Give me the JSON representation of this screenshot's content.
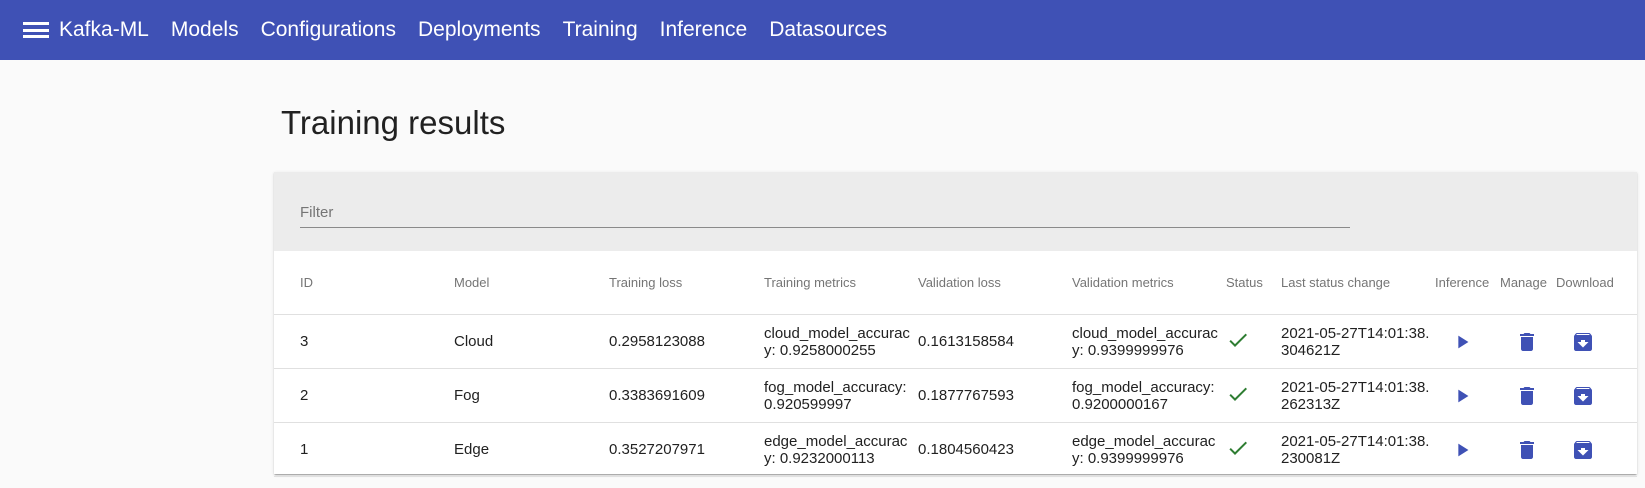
{
  "app": {
    "title": "Kafka-ML",
    "nav": [
      "Models",
      "Configurations",
      "Deployments",
      "Training",
      "Inference",
      "Datasources"
    ]
  },
  "page": {
    "title": "Training results"
  },
  "filter": {
    "placeholder": "Filter",
    "value": ""
  },
  "table": {
    "headers": {
      "id": "ID",
      "model": "Model",
      "training_loss": "Training loss",
      "training_metrics": "Training metrics",
      "validation_loss": "Validation loss",
      "validation_metrics": "Validation metrics",
      "status": "Status",
      "last_status_change": "Last status change",
      "inference": "Inference",
      "manage": "Manage",
      "download": "Download"
    },
    "rows": [
      {
        "id": "3",
        "model": "Cloud",
        "training_loss": "0.2958123088",
        "training_metrics": "cloud_model_accuracy: 0.9258000255",
        "validation_loss": "0.1613158584",
        "validation_metrics": "cloud_model_accuracy: 0.9399999976",
        "status": "check-icon",
        "last_status_change": "2021-05-27T14:01:38.304621Z"
      },
      {
        "id": "2",
        "model": "Fog",
        "training_loss": "0.3383691609",
        "training_metrics": "fog_model_accuracy: 0.920599997",
        "validation_loss": "0.1877767593",
        "validation_metrics": "fog_model_accuracy: 0.9200000167",
        "status": "check-icon",
        "last_status_change": "2021-05-27T14:01:38.262313Z"
      },
      {
        "id": "1",
        "model": "Edge",
        "training_loss": "0.3527207971",
        "training_metrics": "edge_model_accuracy: 0.9232000113",
        "validation_loss": "0.1804560423",
        "validation_metrics": "edge_model_accuracy: 0.9399999976",
        "status": "check-icon",
        "last_status_change": "2021-05-27T14:01:38.230081Z"
      }
    ]
  },
  "icons": {
    "inference": "play-icon",
    "manage": "delete-icon",
    "download": "download-icon"
  },
  "colors": {
    "primary": "#3f51b5",
    "success": "#2e7d32",
    "header_text": "#757575"
  }
}
